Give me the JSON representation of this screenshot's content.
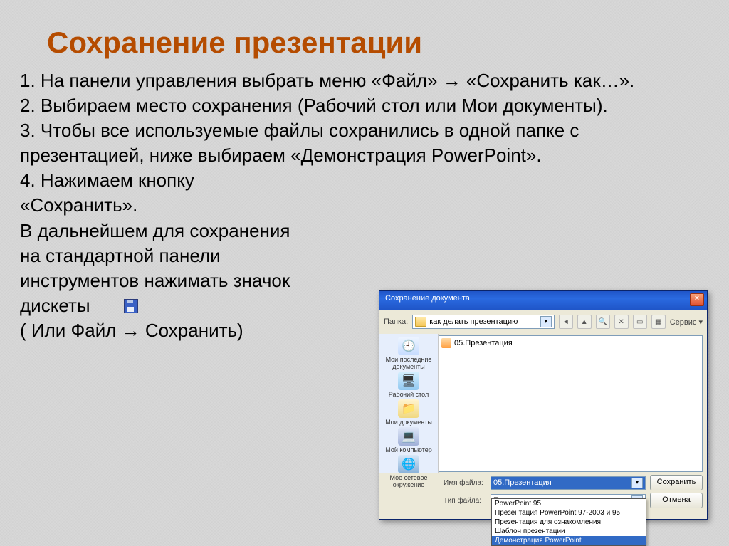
{
  "slide": {
    "title": "Сохранение презентации",
    "step1": "1. На панели управления выбрать меню «Файл» → «Сохранить как…».",
    "step2": "2. Выбираем место сохранения (Рабочий стол или Мои документы).",
    "step3": "3. Чтобы все используемые файлы сохранились в одной папке с презентацией, ниже выбираем «Демонстрация PowerPoint».",
    "step4a": "4. Нажимаем кнопку",
    "step4b": "«Сохранить».",
    "note1": " В дальнейшем для сохранения",
    "note2": "на стандартной панели",
    "note3": "инструментов нажимать значок",
    "note4": "дискеты",
    "note5": "( Или Файл → Сохранить)"
  },
  "dialog": {
    "title": "Сохранение документа",
    "close": "×",
    "folder_label": "Папка:",
    "folder_value": "как делать презентацию",
    "service_label": "Сервис ▾",
    "places": {
      "recent": "Мои последние документы",
      "desktop": "Рабочий стол",
      "docs": "Мои документы",
      "pc": "Мой компьютер",
      "net": "Мое сетевое окружение"
    },
    "file_in_list": "05.Презентация",
    "filename_label": "Имя файла:",
    "filename_value": "05.Презентация",
    "filetype_label": "Тип файла:",
    "filetype_value": "Презентация",
    "save_btn": "Сохранить",
    "cancel_btn": "Отмена",
    "dropdown": [
      "PowerPoint 95",
      "Презентация PowerPoint 97-2003 и 95",
      "Презентация для ознакомления",
      "Шаблон презентации",
      "Демонстрация PowerPoint"
    ]
  }
}
